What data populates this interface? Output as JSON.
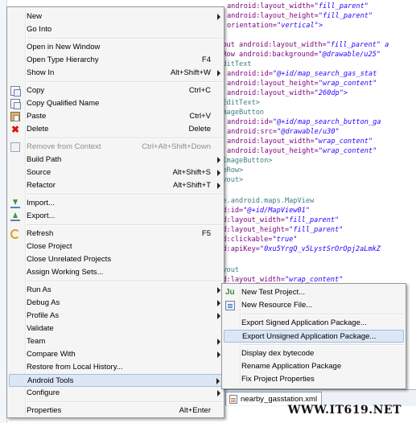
{
  "code_lines": [
    {
      "attr": "android:layout_width=",
      "val": "\"fill_parent\"",
      "pre": "    "
    },
    {
      "attr": "android:layout_height=",
      "val": "\"fill_parent\"",
      "pre": "    "
    },
    {
      "attr": "orientation=",
      "val": "\"vertical\">",
      "pre": "    "
    },
    {
      "attr": "ayout android:layout_width=",
      "val": "\"fill_parent\" a",
      "pre": ""
    },
    {
      "attr": "leRow android:background=",
      "val": "\"@drawable/u25\"",
      "pre": ""
    },
    {
      "tag": "<EditText",
      "pre": ""
    },
    {
      "attr": "android:id=",
      "val": "\"@+id/map_search_gas_stat",
      "pre": "    "
    },
    {
      "attr": "android:layout_height=",
      "val": "\"wrap_content\"",
      "pre": "    "
    },
    {
      "attr": "android:layout_width=",
      "val": "\"260dp\">",
      "pre": "    "
    },
    {
      "tag": "</EditText>",
      "pre": ""
    },
    {
      "tag": "<ImageButton",
      "pre": ""
    },
    {
      "attr": "android:id=",
      "val": "\"@+id/map_search_button_ga",
      "pre": "    "
    },
    {
      "attr": "android:src=",
      "val": "\"@drawable/u30\"",
      "pre": "    "
    },
    {
      "attr": "android:layout_width=",
      "val": "\"wrap_content\"",
      "pre": "    "
    },
    {
      "attr": "android:layout_height=",
      "val": "\"wrap_content\"",
      "pre": "    "
    },
    {
      "tag": "</ImageButton>",
      "pre": ""
    },
    {
      "tag": "bleRow>",
      "pre": ""
    },
    {
      "tag": "Layout>",
      "pre": ""
    },
    {
      "tag": "",
      "pre": ""
    },
    {
      "tag": "gle.android.maps.MapView",
      "pre": ""
    },
    {
      "attr": "oid:id=",
      "val": "\"@+id/MapView01\"",
      "pre": ""
    },
    {
      "attr": "oid:layout_width=",
      "val": "\"fill_parent\"",
      "pre": ""
    },
    {
      "attr": "oid:layout_height=",
      "val": "\"fill_parent\"",
      "pre": ""
    },
    {
      "attr": "oid:clickable=",
      "val": "\"true\"",
      "pre": ""
    },
    {
      "attr": "oid:apiKey=",
      "val": "\"0xu5YrgQ_v5LystSrOrOpj2aLmkZ",
      "pre": ""
    },
    {
      "tag": "",
      "pre": ""
    },
    {
      "tag": "Layout",
      "pre": ""
    },
    {
      "attr": "oid:layout_width=",
      "val": "\"wrap_content\"",
      "pre": ""
    }
  ],
  "context_menu": {
    "items": [
      {
        "type": "item",
        "label": "New",
        "shortcut": "",
        "submenu": true,
        "icon": ""
      },
      {
        "type": "item",
        "label": "Go Into",
        "shortcut": "",
        "submenu": false,
        "icon": ""
      },
      {
        "type": "sep"
      },
      {
        "type": "item",
        "label": "Open in New Window",
        "shortcut": "",
        "submenu": false,
        "icon": ""
      },
      {
        "type": "item",
        "label": "Open Type Hierarchy",
        "shortcut": "F4",
        "submenu": false,
        "icon": ""
      },
      {
        "type": "item",
        "label": "Show In",
        "shortcut": "Alt+Shift+W",
        "submenu": true,
        "icon": ""
      },
      {
        "type": "sep"
      },
      {
        "type": "item",
        "label": "Copy",
        "shortcut": "Ctrl+C",
        "submenu": false,
        "icon": "copy-icon"
      },
      {
        "type": "item",
        "label": "Copy Qualified Name",
        "shortcut": "",
        "submenu": false,
        "icon": "copy-icon"
      },
      {
        "type": "item",
        "label": "Paste",
        "shortcut": "Ctrl+V",
        "submenu": false,
        "icon": "paste-icon"
      },
      {
        "type": "item",
        "label": "Delete",
        "shortcut": "Delete",
        "submenu": false,
        "icon": "delete-icon"
      },
      {
        "type": "sep"
      },
      {
        "type": "item",
        "label": "Remove from Context",
        "shortcut": "Ctrl+Alt+Shift+Down",
        "submenu": false,
        "icon": "remove-context-icon",
        "disabled": true
      },
      {
        "type": "item",
        "label": "Build Path",
        "shortcut": "",
        "submenu": true,
        "icon": ""
      },
      {
        "type": "item",
        "label": "Source",
        "shortcut": "Alt+Shift+S",
        "submenu": true,
        "icon": ""
      },
      {
        "type": "item",
        "label": "Refactor",
        "shortcut": "Alt+Shift+T",
        "submenu": true,
        "icon": ""
      },
      {
        "type": "sep"
      },
      {
        "type": "item",
        "label": "Import...",
        "shortcut": "",
        "submenu": false,
        "icon": "import-icon"
      },
      {
        "type": "item",
        "label": "Export...",
        "shortcut": "",
        "submenu": false,
        "icon": "export-icon"
      },
      {
        "type": "sep"
      },
      {
        "type": "item",
        "label": "Refresh",
        "shortcut": "F5",
        "submenu": false,
        "icon": "refresh-icon"
      },
      {
        "type": "item",
        "label": "Close Project",
        "shortcut": "",
        "submenu": false,
        "icon": ""
      },
      {
        "type": "item",
        "label": "Close Unrelated Projects",
        "shortcut": "",
        "submenu": false,
        "icon": ""
      },
      {
        "type": "item",
        "label": "Assign Working Sets...",
        "shortcut": "",
        "submenu": false,
        "icon": ""
      },
      {
        "type": "sep"
      },
      {
        "type": "item",
        "label": "Run As",
        "shortcut": "",
        "submenu": true,
        "icon": ""
      },
      {
        "type": "item",
        "label": "Debug As",
        "shortcut": "",
        "submenu": true,
        "icon": ""
      },
      {
        "type": "item",
        "label": "Profile As",
        "shortcut": "",
        "submenu": true,
        "icon": ""
      },
      {
        "type": "item",
        "label": "Validate",
        "shortcut": "",
        "submenu": false,
        "icon": ""
      },
      {
        "type": "item",
        "label": "Team",
        "shortcut": "",
        "submenu": true,
        "icon": ""
      },
      {
        "type": "item",
        "label": "Compare With",
        "shortcut": "",
        "submenu": true,
        "icon": ""
      },
      {
        "type": "item",
        "label": "Restore from Local History...",
        "shortcut": "",
        "submenu": false,
        "icon": ""
      },
      {
        "type": "item",
        "label": "Android Tools",
        "shortcut": "",
        "submenu": true,
        "icon": "",
        "highlighted": true
      },
      {
        "type": "item",
        "label": "Configure",
        "shortcut": "",
        "submenu": true,
        "icon": ""
      },
      {
        "type": "sep"
      },
      {
        "type": "item",
        "label": "Properties",
        "shortcut": "Alt+Enter",
        "submenu": false,
        "icon": ""
      }
    ]
  },
  "android_tools_menu": {
    "items": [
      {
        "type": "item",
        "label": "New Test Project...",
        "icon": "test-project-icon"
      },
      {
        "type": "item",
        "label": "New Resource File...",
        "icon": "resource-file-icon"
      },
      {
        "type": "sep"
      },
      {
        "type": "item",
        "label": "Export Signed Application Package..."
      },
      {
        "type": "item",
        "label": "Export Unsigned Application Package...",
        "highlighted": true
      },
      {
        "type": "sep"
      },
      {
        "type": "item",
        "label": "Display dex bytecode"
      },
      {
        "type": "item",
        "label": "Rename Application Package"
      },
      {
        "type": "item",
        "label": "Fix Project Properties"
      }
    ]
  },
  "editor_tab": {
    "label": "nearby_gasstation.xml",
    "icon": "xml-file-icon"
  },
  "watermark": "WWW.IT619.NET"
}
